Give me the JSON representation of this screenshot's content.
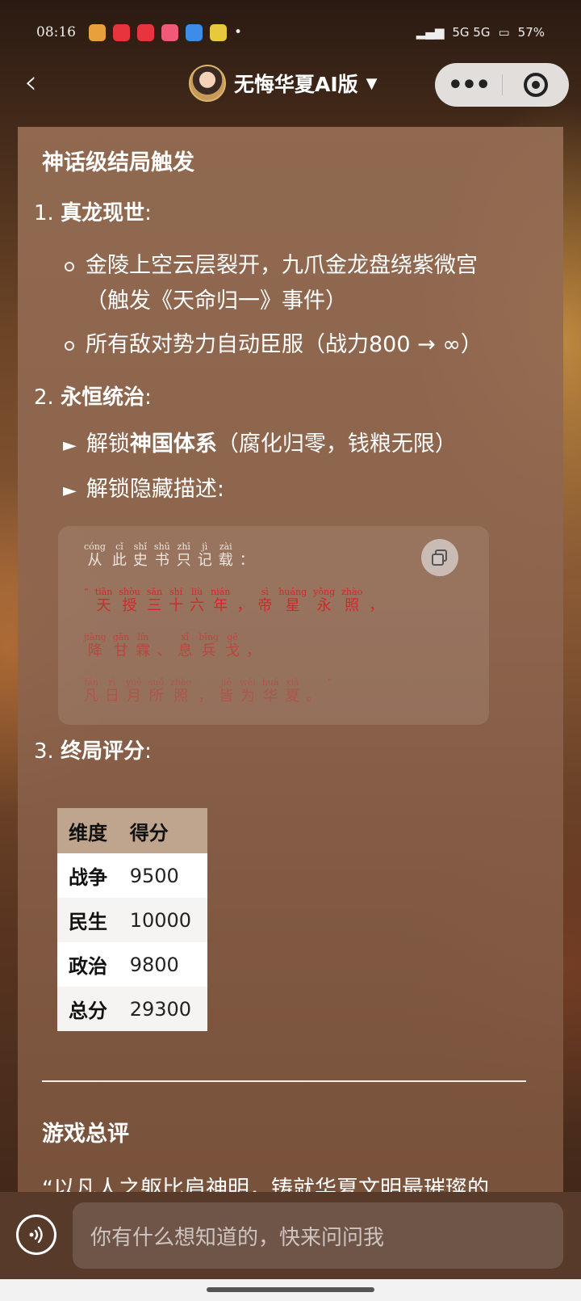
{
  "status_bar": {
    "time": "08:16",
    "network": "5G 5G",
    "battery": "57%",
    "app_colors": [
      "#e8a03c",
      "#e8343c",
      "#e8343c",
      "#f05a78",
      "#3c8ce8",
      "#e8c83c"
    ]
  },
  "nav": {
    "title": "无悔华夏AI版",
    "caret": "▼",
    "back": "‹",
    "more": "•••"
  },
  "content": {
    "heading": "神话级结局触发",
    "item1": {
      "num": "1.",
      "title": "真龙现世",
      "colon": ":",
      "bullets": [
        "金陵上空云层裂开，九爪金龙盘绕紫微宫",
        "（触发《天命归一》事件）",
        "所有敌对势力自动臣服（战力800 → ∞）"
      ]
    },
    "item2": {
      "num": "2.",
      "title": "永恒统治",
      "colon": ":",
      "arrow": "►",
      "line1_prefix": "解锁",
      "line1_bold": "神国体系",
      "line1_suffix": "（腐化归零，钱粮无限）",
      "line2": "解锁隐藏描述:"
    },
    "quote": {
      "line1": [
        {
          "py": "cóng",
          "hz": "从"
        },
        {
          "py": "cǐ",
          "hz": "此"
        },
        {
          "py": "shǐ",
          "hz": "史"
        },
        {
          "py": "shū",
          "hz": "书"
        },
        {
          "py": "zhī",
          "hz": "只"
        },
        {
          "py": "jì",
          "hz": "记"
        },
        {
          "py": "zài",
          "hz": "载"
        },
        {
          "py": "",
          "hz": "："
        }
      ],
      "line2": [
        {
          "py": "“",
          "hz": ""
        },
        {
          "py": "tiān",
          "hz": "天"
        },
        {
          "py": "shòu",
          "hz": "授"
        },
        {
          "py": "sān",
          "hz": "三"
        },
        {
          "py": "shí",
          "hz": "十"
        },
        {
          "py": "liù",
          "hz": "六"
        },
        {
          "py": "nián",
          "hz": "年"
        },
        {
          "py": "",
          "hz": "，"
        },
        {
          "py": "sì",
          "hz": "帝"
        },
        {
          "py": "huáng",
          "hz": "星"
        },
        {
          "py": "yǒng",
          "hz": "永"
        },
        {
          "py": "zhào",
          "hz": "照"
        },
        {
          "py": "",
          "hz": "，"
        }
      ],
      "line3": [
        {
          "py": "jiàng",
          "hz": "降"
        },
        {
          "py": "gān",
          "hz": "甘"
        },
        {
          "py": "lín",
          "hz": "霖"
        },
        {
          "py": "",
          "hz": "、"
        },
        {
          "py": "xī",
          "hz": "息"
        },
        {
          "py": "bīng",
          "hz": "兵"
        },
        {
          "py": "gē",
          "hz": "戈"
        },
        {
          "py": "",
          "hz": "，"
        }
      ],
      "line4": [
        {
          "py": "fán",
          "hz": "凡"
        },
        {
          "py": "rì",
          "hz": "日"
        },
        {
          "py": "yuè",
          "hz": "月"
        },
        {
          "py": "suǒ",
          "hz": "所"
        },
        {
          "py": "zhào",
          "hz": "照"
        },
        {
          "py": "",
          "hz": "，"
        },
        {
          "py": "jiē",
          "hz": "皆"
        },
        {
          "py": "wéi",
          "hz": "为"
        },
        {
          "py": "huá",
          "hz": "华"
        },
        {
          "py": "xià",
          "hz": "夏"
        },
        {
          "py": "",
          "hz": "。"
        },
        {
          "py": "”",
          "hz": ""
        }
      ]
    },
    "item3": {
      "num": "3.",
      "title": "终局评分",
      "colon": ":"
    },
    "table": {
      "headers": [
        "维度",
        "得分"
      ],
      "rows": [
        [
          "战争",
          "9500"
        ],
        [
          "民生",
          "10000"
        ],
        [
          "政治",
          "9800"
        ],
        [
          "总分",
          "29300"
        ]
      ]
    },
    "summary_title": "游戏总评",
    "summary_text": "“以凡人之躯比肩神明，铸就华夏文明最璀璨的"
  },
  "input": {
    "placeholder": "你有什么想知道的，快来问问我"
  }
}
